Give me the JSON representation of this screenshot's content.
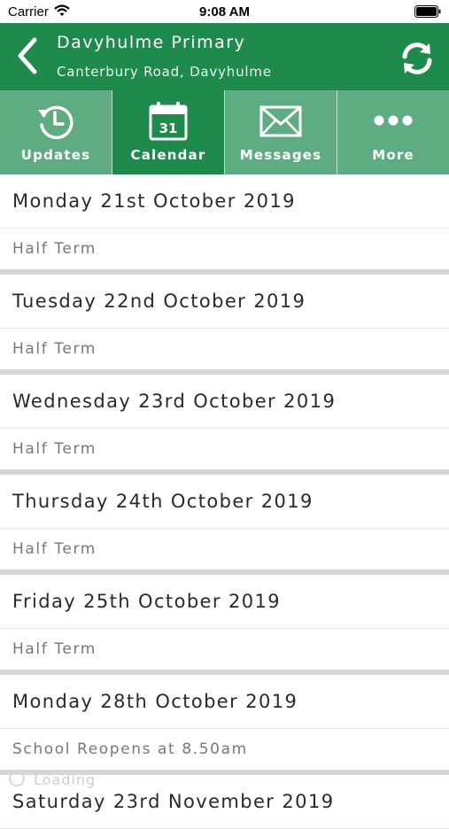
{
  "status_bar": {
    "carrier": "Carrier",
    "time": "9:08 AM"
  },
  "header": {
    "title": "Davyhulme Primary",
    "subtitle": "Canterbury Road, Davyhulme",
    "back_icon": "chevron-left-icon",
    "refresh_icon": "refresh-icon"
  },
  "tabs": [
    {
      "label": "Updates",
      "icon": "clock-history-icon",
      "active": false
    },
    {
      "label": "Calendar",
      "icon": "calendar-icon",
      "active": true,
      "icon_text": "31"
    },
    {
      "label": "Messages",
      "icon": "envelope-icon",
      "active": false
    },
    {
      "label": "More",
      "icon": "more-dots-icon",
      "active": false
    }
  ],
  "events": [
    {
      "date": "Monday 21st October 2019",
      "items": [
        "Half Term"
      ]
    },
    {
      "date": "Tuesday 22nd October 2019",
      "items": [
        "Half Term"
      ]
    },
    {
      "date": "Wednesday 23rd October 2019",
      "items": [
        "Half Term"
      ]
    },
    {
      "date": "Thursday 24th October 2019",
      "items": [
        "Half Term"
      ]
    },
    {
      "date": "Friday 25th October 2019",
      "items": [
        "Half Term"
      ]
    },
    {
      "date": "Monday 28th October 2019",
      "items": [
        "School Reopens at 8.50am"
      ]
    },
    {
      "date": "Saturday 23rd November 2019",
      "items": []
    }
  ],
  "loading_text": "Loading",
  "colors": {
    "brand_green": "#1e8b4d",
    "tab_inactive": "#5fac82"
  }
}
